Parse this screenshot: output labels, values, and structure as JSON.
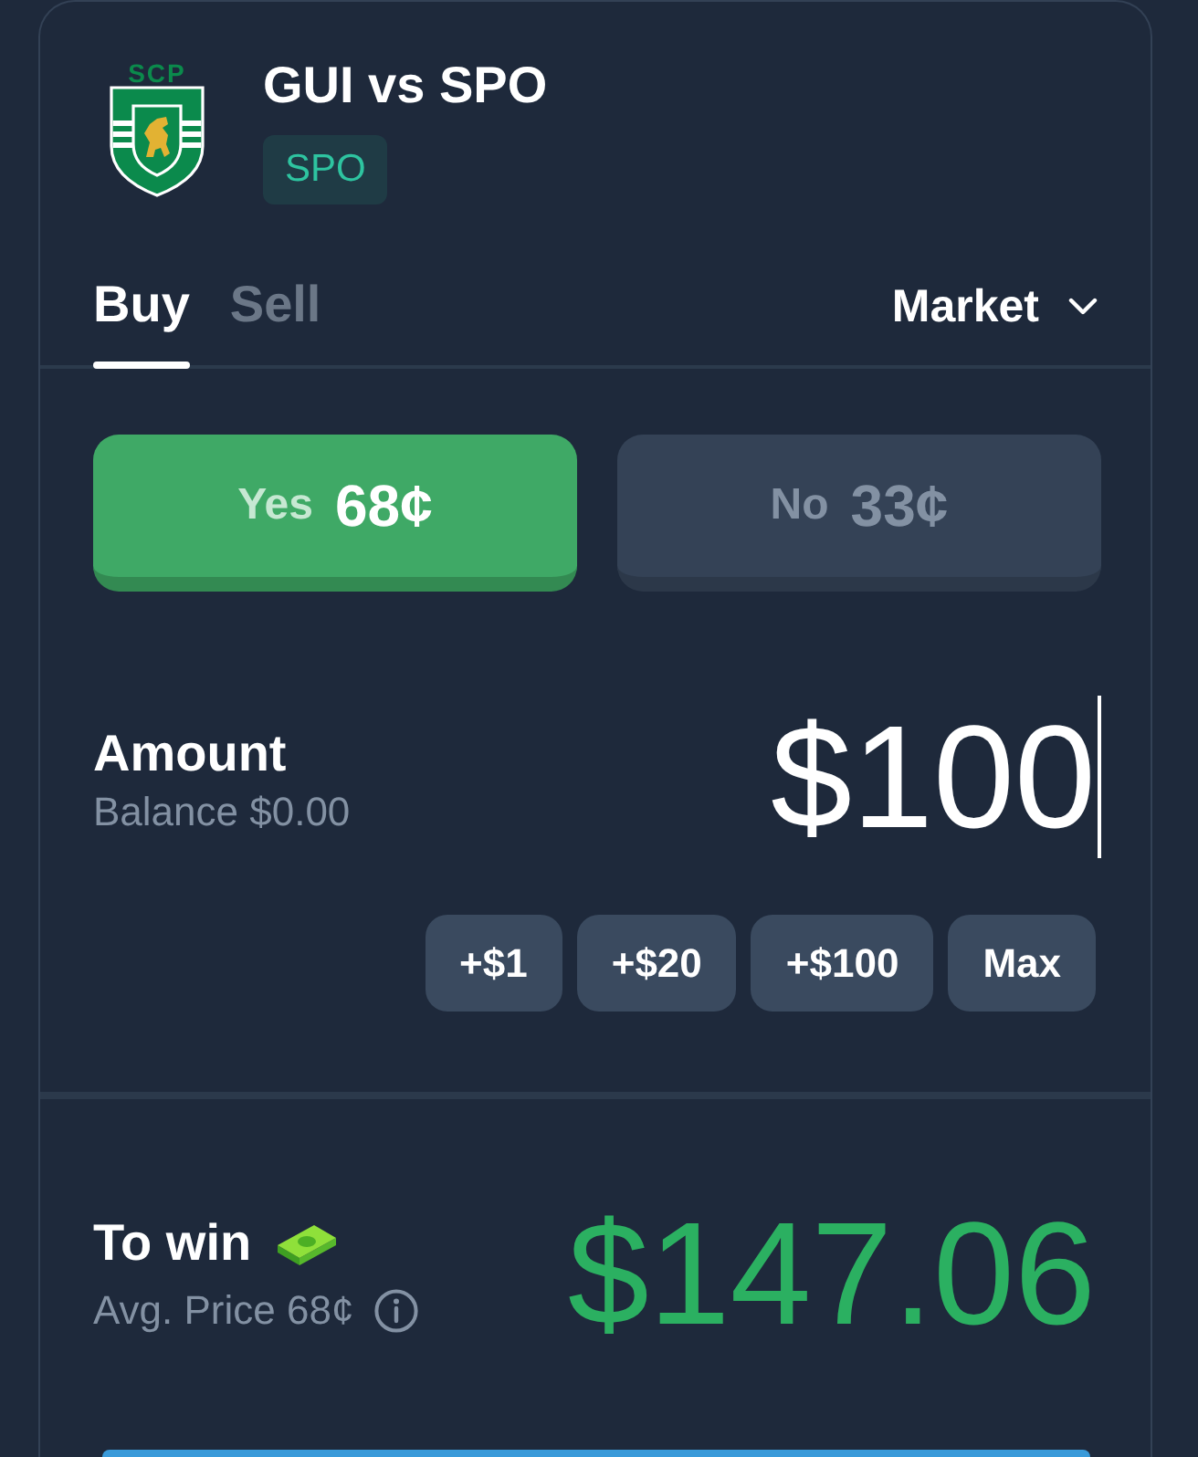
{
  "market": {
    "crest_letters": "SCP",
    "title": "GUI vs SPO",
    "badge": "SPO"
  },
  "tabs": [
    {
      "label": "Buy",
      "selected": true
    },
    {
      "label": "Sell",
      "selected": false
    }
  ],
  "order_type": {
    "label": "Market"
  },
  "outcomes": [
    {
      "label": "Yes",
      "price": "68¢",
      "kind": "yes",
      "selected": true
    },
    {
      "label": "No",
      "price": "33¢",
      "kind": "no",
      "selected": false
    }
  ],
  "amount": {
    "label": "Amount",
    "balance": "Balance $0.00",
    "value": "$100"
  },
  "quick_amounts": [
    "+$1",
    "+$20",
    "+$100",
    "Max"
  ],
  "payout": {
    "label": "To win",
    "avg_price": "Avg. Price 68¢",
    "value": "$147.06"
  }
}
